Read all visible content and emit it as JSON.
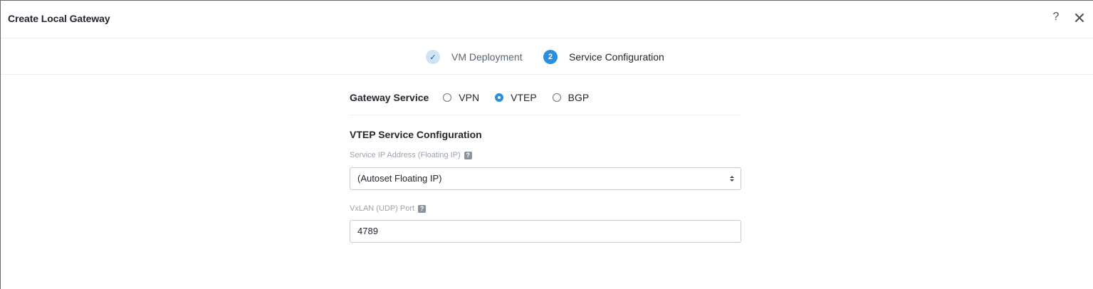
{
  "dialog": {
    "title": "Create Local Gateway",
    "help_label": "?",
    "close_icon": "close-icon"
  },
  "wizard": {
    "steps": [
      {
        "number": "✓",
        "label": "VM Deployment",
        "state": "done"
      },
      {
        "number": "2",
        "label": "Service Configuration",
        "state": "active"
      }
    ]
  },
  "form": {
    "gateway_service": {
      "label": "Gateway Service",
      "options": [
        "VPN",
        "VTEP",
        "BGP"
      ],
      "selected": "VTEP"
    },
    "section_title": "VTEP Service Configuration",
    "service_ip": {
      "label": "Service IP Address (Floating IP)",
      "help": "?",
      "value": "(Autoset Floating IP)"
    },
    "vxlan_port": {
      "label": "VxLAN (UDP) Port",
      "help": "?",
      "value": "4789"
    }
  },
  "colors": {
    "accent": "#2b8fe0",
    "step_done_bg": "#cfe4f5",
    "muted_label": "#9aa3ad"
  }
}
